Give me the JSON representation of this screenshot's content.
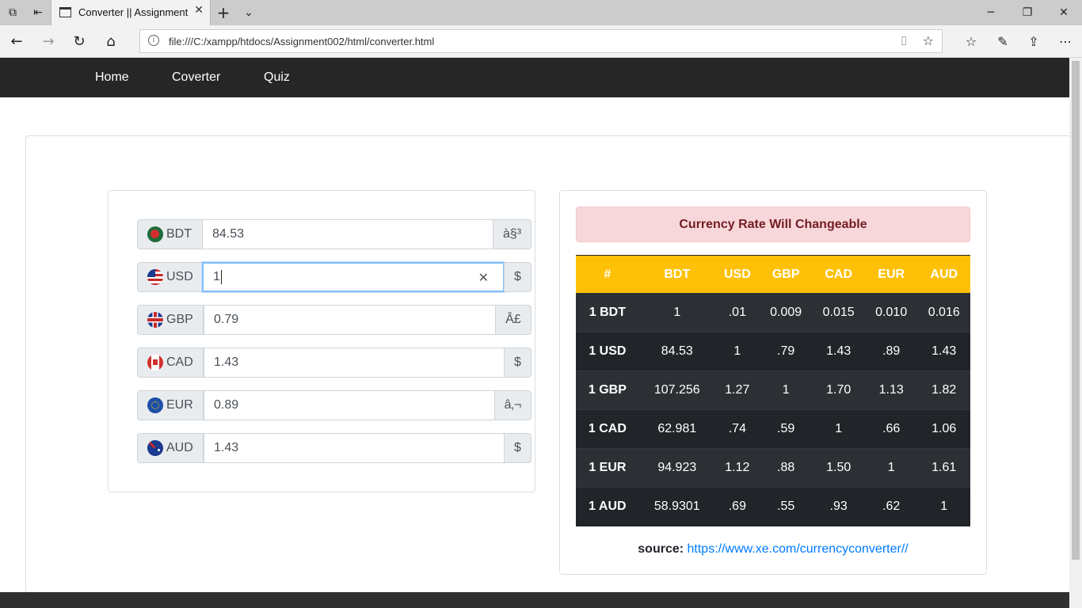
{
  "browser": {
    "tab_title": "Converter || Assignment",
    "url": "file:///C:/xampp/htdocs/Assignment002/html/converter.html"
  },
  "nav": {
    "items": [
      "Home",
      "Coverter",
      "Quiz"
    ]
  },
  "converter": {
    "rows": [
      {
        "code": "BDT",
        "value": "84.53",
        "symbol": "à§³",
        "flag": "bangladesh-flag-icon"
      },
      {
        "code": "USD",
        "value": "1",
        "symbol": "$",
        "flag": "usa-flag-icon"
      },
      {
        "code": "GBP",
        "value": "0.79",
        "symbol": "Â£",
        "flag": "uk-flag-icon"
      },
      {
        "code": "CAD",
        "value": "1.43",
        "symbol": "$",
        "flag": "canada-flag-icon"
      },
      {
        "code": "EUR",
        "value": "0.89",
        "symbol": "â‚¬",
        "flag": "eu-flag-icon"
      },
      {
        "code": "AUD",
        "value": "1.43",
        "symbol": "$",
        "flag": "australia-flag-icon"
      }
    ]
  },
  "rates": {
    "alert": "Currency Rate Will Changeable",
    "headers": [
      "#",
      "BDT",
      "USD",
      "GBP",
      "CAD",
      "EUR",
      "AUD"
    ],
    "rows": [
      [
        "1 BDT",
        "1",
        ".01",
        "0.009",
        "0.015",
        "0.010",
        "0.016"
      ],
      [
        "1 USD",
        "84.53",
        "1",
        ".79",
        "1.43",
        ".89",
        "1.43"
      ],
      [
        "1 GBP",
        "107.256",
        "1.27",
        "1",
        "1.70",
        "1.13",
        "1.82"
      ],
      [
        "1 CAD",
        "62.981",
        ".74",
        ".59",
        "1",
        ".66",
        "1.06"
      ],
      [
        "1 EUR",
        "94.923",
        "1.12",
        ".88",
        "1.50",
        "1",
        "1.61"
      ],
      [
        "1 AUD",
        "58.9301",
        ".69",
        ".55",
        ".93",
        ".62",
        "1"
      ]
    ],
    "source_label": "source:",
    "source_link": "https://www.xe.com/currencyconverter//"
  }
}
